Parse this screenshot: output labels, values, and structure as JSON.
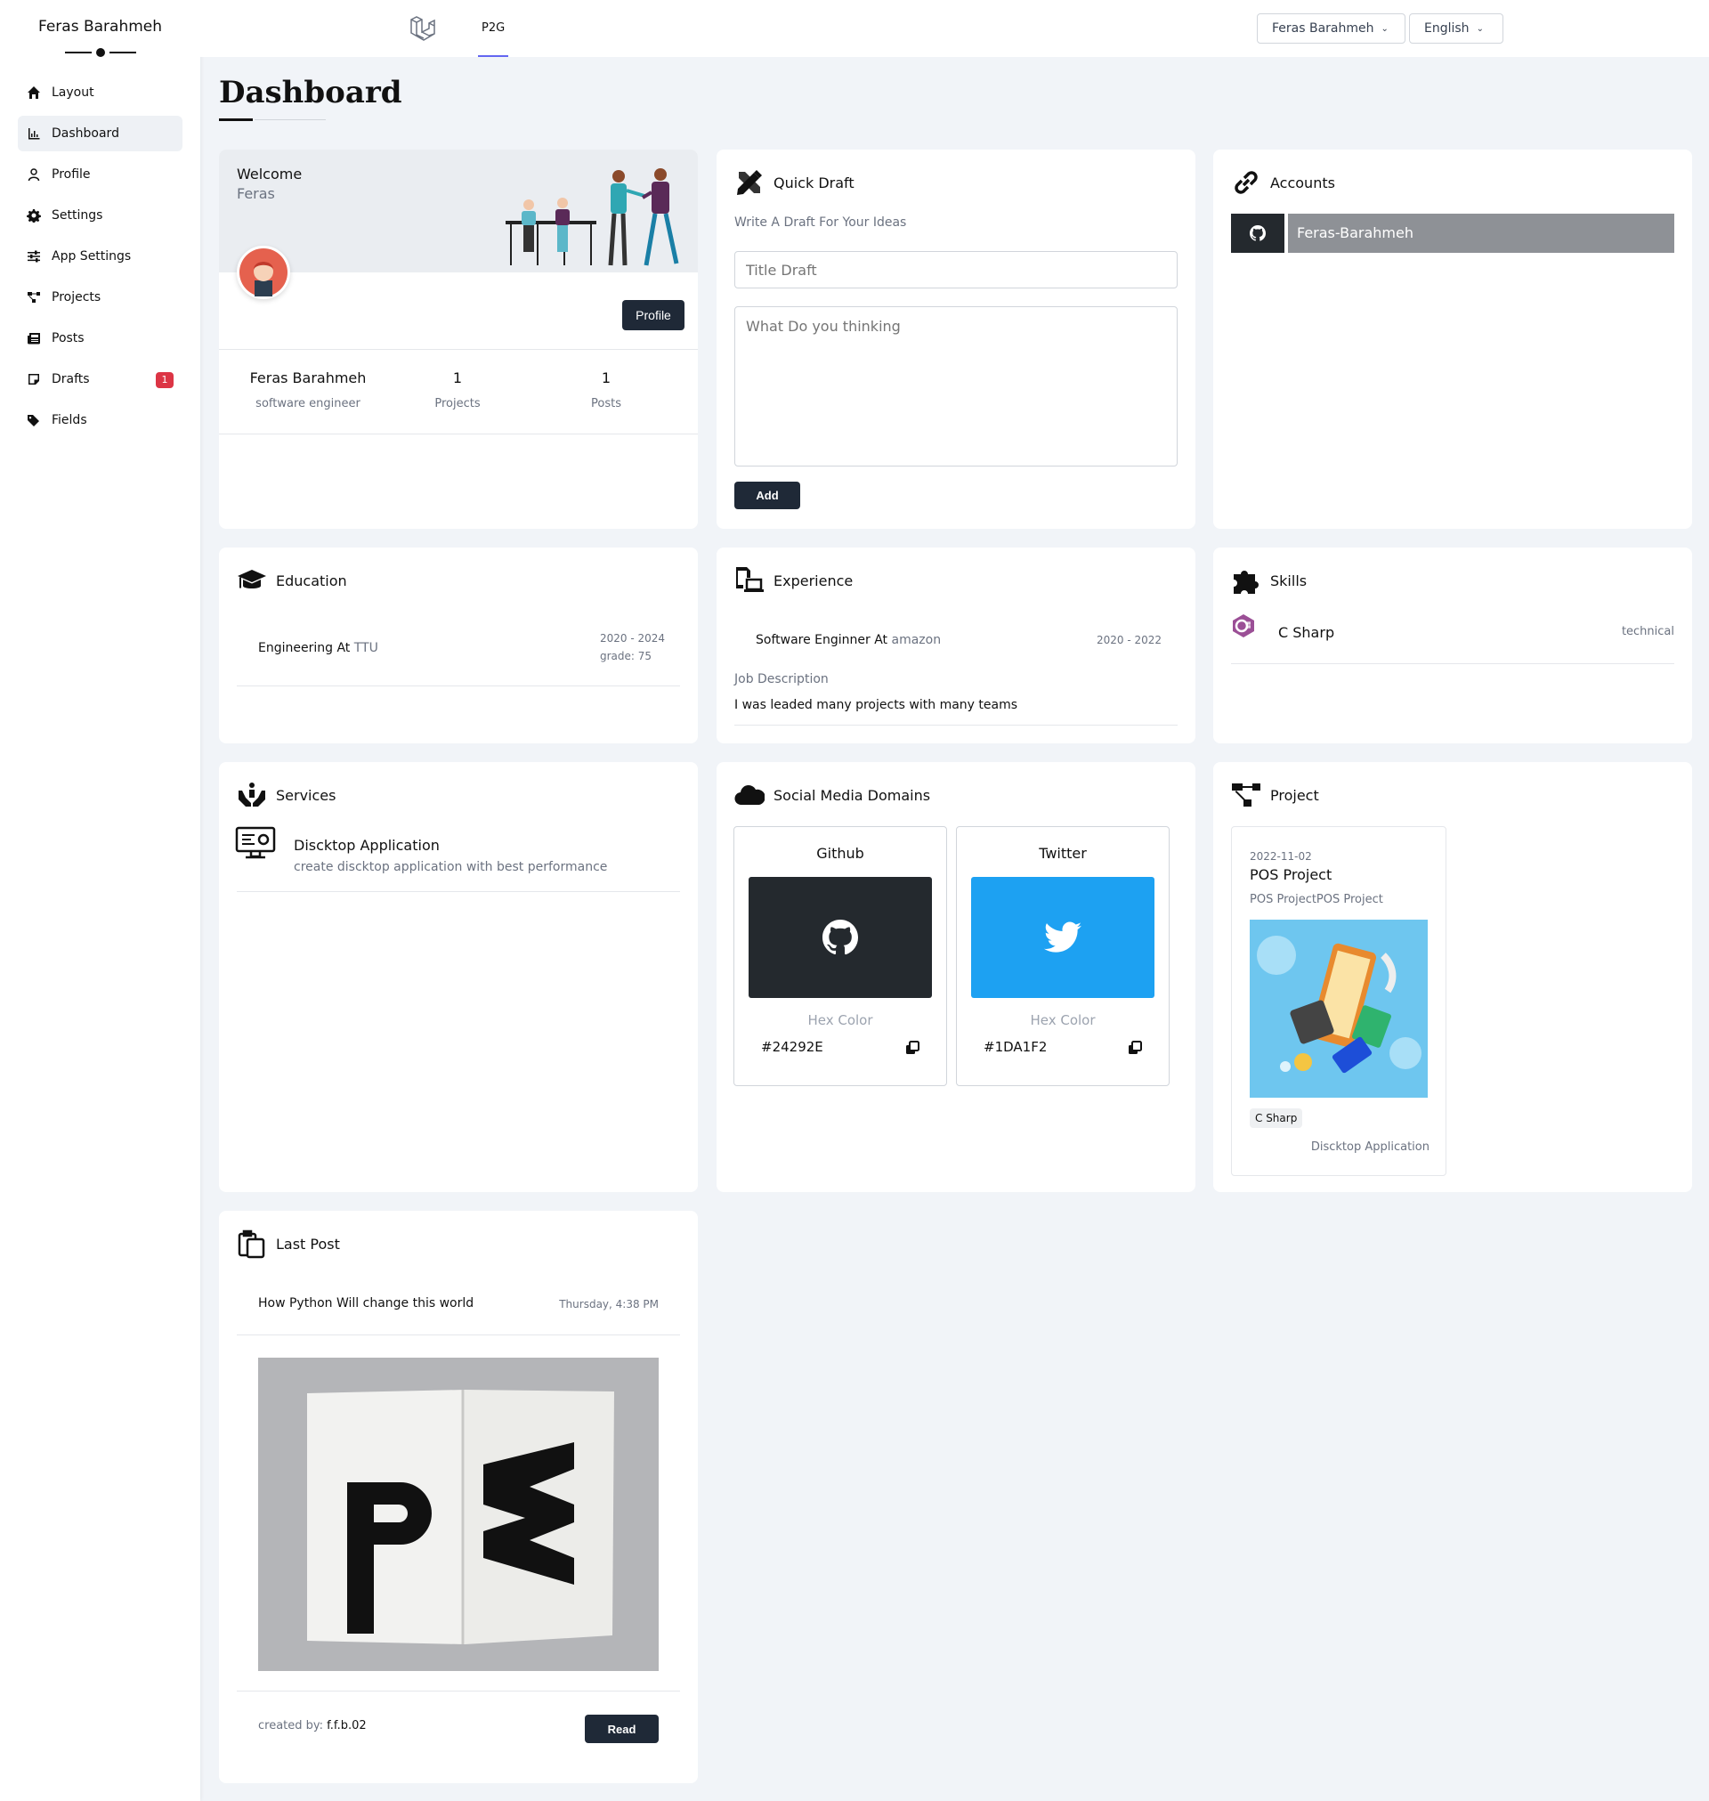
{
  "sidebar": {
    "user_name": "Feras Barahmeh",
    "items": [
      {
        "label": "Layout",
        "icon": "home-icon"
      },
      {
        "label": "Dashboard",
        "icon": "chart-icon"
      },
      {
        "label": "Profile",
        "icon": "user-icon"
      },
      {
        "label": "Settings",
        "icon": "gear-icon"
      },
      {
        "label": "App Settings",
        "icon": "sliders-icon"
      },
      {
        "label": "Projects",
        "icon": "project-diagram-icon"
      },
      {
        "label": "Posts",
        "icon": "newspaper-icon"
      },
      {
        "label": "Drafts",
        "icon": "sticky-note-icon",
        "badge": "1"
      },
      {
        "label": "Fields",
        "icon": "tags-icon"
      }
    ]
  },
  "topbar": {
    "tab": "P2G",
    "user_dropdown": "Feras Barahmeh",
    "language_dropdown": "English"
  },
  "page": {
    "title": "Dashboard"
  },
  "welcome": {
    "heading": "Welcome",
    "name": "Feras",
    "profile_button": "Profile",
    "full_name": "Feras Barahmeh",
    "job": "software engineer",
    "projects_count": "1",
    "projects_label": "Projects",
    "posts_count": "1",
    "posts_label": "Posts"
  },
  "quick_draft": {
    "title": "Quick Draft",
    "subtitle": "Write A Draft For Your Ideas",
    "title_placeholder": "Title Draft",
    "body_placeholder": "What Do you thinking",
    "add_button": "Add"
  },
  "accounts": {
    "title": "Accounts",
    "github_account": "Feras-Barahmeh"
  },
  "education": {
    "title": "Education",
    "degree": "Engineering At",
    "school": "TTU",
    "years": "2020 - 2024",
    "grade": "grade: 75"
  },
  "experience": {
    "title": "Experience",
    "role": "Software Enginner At",
    "company": "amazon",
    "years": "2020 - 2022",
    "desc_label": "Job Description",
    "desc": "I was leaded many projects with many teams"
  },
  "skills": {
    "title": "Skills",
    "name": "C Sharp",
    "type": "technical"
  },
  "services": {
    "title": "Services",
    "name": "Discktop Application",
    "desc": "create discktop application with best performance"
  },
  "social": {
    "title": "Social Media Domains",
    "hex_label": "Hex Color",
    "items": [
      {
        "name": "Github",
        "hex": "#24292E",
        "color": "#24292E"
      },
      {
        "name": "Twitter",
        "hex": "#1DA1F2",
        "color": "#1DA1F2"
      }
    ]
  },
  "project": {
    "title": "Project",
    "date": "2022-11-02",
    "name": "POS Project",
    "desc": "POS ProjectPOS Project",
    "tag": "C Sharp",
    "service": "Discktop Application"
  },
  "last_post": {
    "title": "Last Post",
    "post_title": "How Python Will change this world",
    "time": "Thursday, 4:38 PM",
    "created_by_label": "created by:",
    "author": "f.f.b.02",
    "read_button": "Read"
  }
}
